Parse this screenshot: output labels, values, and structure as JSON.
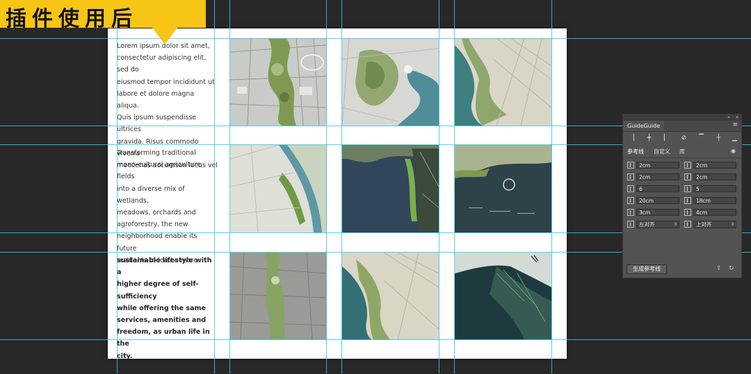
{
  "badge": {
    "text": "插件使用后"
  },
  "paragraphs": [
    {
      "lines": [
        "Lorem ipsum dolor sit amet,",
        "consectetur adipiscing elit, sed do",
        "eiusmod tempor incididunt ut",
        "labore et dolore magna aliqua.",
        "Quis ipsum suspendisse ultrices",
        "gravida. Risus commodo viverra",
        "maecenas accumsan lacus vel"
      ]
    },
    {
      "lines": [
        " Transforming traditional",
        "mono-cultural agriculture fields",
        "into a diverse mix of wetlands,",
        "meadows, orchards and",
        "agroforestry, the new",
        "neighborhood enable its future",
        "residents to lead a more"
      ]
    },
    {
      "lines": [
        " sustainable lifestyle with a",
        "higher degree of self-sufficiency",
        "while offering the same",
        "services, amenities and",
        "freedom, as urban life in the",
        "city.",
        "\\"
      ]
    }
  ],
  "thumbnails": [
    "aerial-urban-park-plan-1",
    "aerial-waterfront-park-2",
    "aerial-riverside-district-3",
    "aerial-river-bend-4",
    "aerial-lake-peninsula-5",
    "aerial-bay-city-6",
    "aerial-grey-corridor-7",
    "aerial-coastal-district-8",
    "aerial-delta-wetland-9"
  ],
  "panel": {
    "title": "GuideGuide",
    "controls": [
      "«",
      "×"
    ],
    "menu": "≡",
    "tabs": {
      "guides": "参考线",
      "custom": "自定义",
      "library": "库"
    },
    "fields": {
      "left_margin": "2cm",
      "top_margin": "2cm",
      "right_margin": "2cm",
      "bottom_margin": "2cm",
      "columns": "6",
      "rows": "5",
      "column_width": "20cm",
      "row_height": "18cm",
      "column_gutter": "3cm",
      "row_gutter": "4cm"
    },
    "selects": {
      "horizontal_align": "左对齐",
      "vertical_align": "上对齐"
    },
    "generate_button": "生成参考线",
    "colors": {
      "panel_bg": "#535353",
      "field_bg": "#454545",
      "guide": "#33c8e6",
      "badge": "#f6c516"
    }
  }
}
